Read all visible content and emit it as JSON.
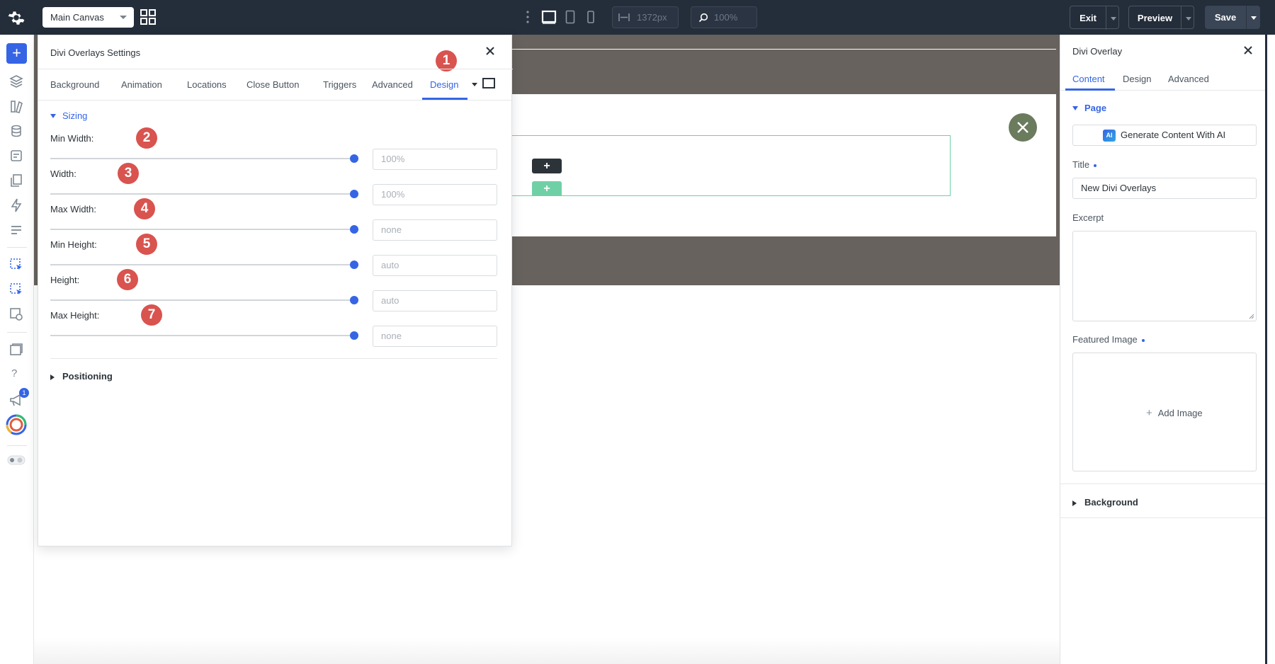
{
  "topbar": {
    "canvas_select": "Main Canvas",
    "width_value": "1372px",
    "zoom_value": "100%",
    "exit_label": "Exit",
    "preview_label": "Preview",
    "save_label": "Save"
  },
  "sidebar": {
    "notification_count": "1"
  },
  "modal": {
    "title": "Divi Overlays Settings",
    "tabs": [
      "Background",
      "Animation",
      "Locations",
      "Close Button",
      "Triggers",
      "Advanced",
      "Design"
    ],
    "active_tab": "Design",
    "sections": {
      "sizing": "Sizing",
      "positioning": "Positioning"
    },
    "fields": [
      {
        "label": "Min Width:",
        "value": "100%",
        "badge": "2"
      },
      {
        "label": "Width:",
        "value": "100%",
        "badge": "3"
      },
      {
        "label": "Max Width:",
        "value": "none",
        "badge": "4"
      },
      {
        "label": "Min Height:",
        "value": "auto",
        "badge": "5"
      },
      {
        "label": "Height:",
        "value": "auto",
        "badge": "6"
      },
      {
        "label": "Max Height:",
        "value": "none",
        "badge": "7"
      }
    ],
    "tab_badge": "1"
  },
  "right_panel": {
    "title": "Divi Overlay",
    "tabs": [
      "Content",
      "Design",
      "Advanced"
    ],
    "active_tab": "Content",
    "page_section": "Page",
    "ai_button": "Generate Content With AI",
    "ai_badge": "AI",
    "title_label": "Title",
    "title_value": "New Divi Overlays",
    "excerpt_label": "Excerpt",
    "featured_image_label": "Featured Image",
    "add_image_label": "Add Image",
    "background_section": "Background"
  },
  "colors": {
    "accent": "#3565e5",
    "topbar": "#242d3a",
    "badge": "#d9534f",
    "canvas_section": "#67625e",
    "row_outline": "#6fd0a6"
  }
}
